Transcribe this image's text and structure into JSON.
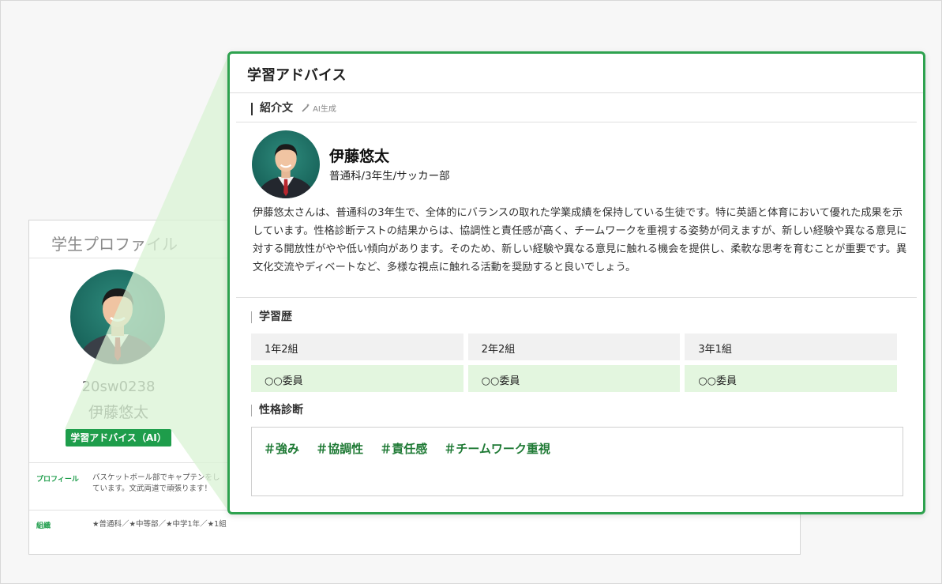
{
  "background_card": {
    "header": "学生プロファイル",
    "student_id": "20sw0238",
    "student_name": "伊藤悠太",
    "badge": "学習アドバイス（AI）",
    "profile_label": "プロフィール",
    "profile_text": "バスケットボール部でキャプテンをしています。文武両道で頑張ります！",
    "org_label": "組織",
    "org_text": "★普通科／★中等部／★中学1年／★1組"
  },
  "advice": {
    "title": "学習アドバイス",
    "intro_heading": "紹介文",
    "ai_generated": "AI生成",
    "student_name": "伊藤悠太",
    "student_sub": "普通科/3年生/サッカー部",
    "intro_text": "伊藤悠太さんは、普通科の3年生で、全体的にバランスの取れた学業成績を保持している生徒です。特に英語と体育において優れた成果を示しています。性格診断テストの結果からは、協調性と責任感が高く、チームワークを重視する姿勢が伺えますが、新しい経験や異なる意見に対する開放性がやや低い傾向があります。そのため、新しい経験や異なる意見に触れる機会を提供し、柔軟な思考を育むことが重要です。異文化交流やディベートなど、多様な視点に触れる活動を奨励すると良いでしょう。",
    "history_heading": "学習歴",
    "history": [
      {
        "class": "1年2組",
        "role": "○○委員"
      },
      {
        "class": "2年2組",
        "role": "○○委員"
      },
      {
        "class": "3年1組",
        "role": "○○委員"
      }
    ],
    "personality_heading": "性格診断",
    "tags": [
      "＃強み",
      "＃協調性",
      "＃責任感",
      "＃チームワーク重視"
    ]
  },
  "colors": {
    "accent_green": "#2ea24f",
    "tag_green": "#1f7a35",
    "wedge_green": "#d9f3d4"
  }
}
